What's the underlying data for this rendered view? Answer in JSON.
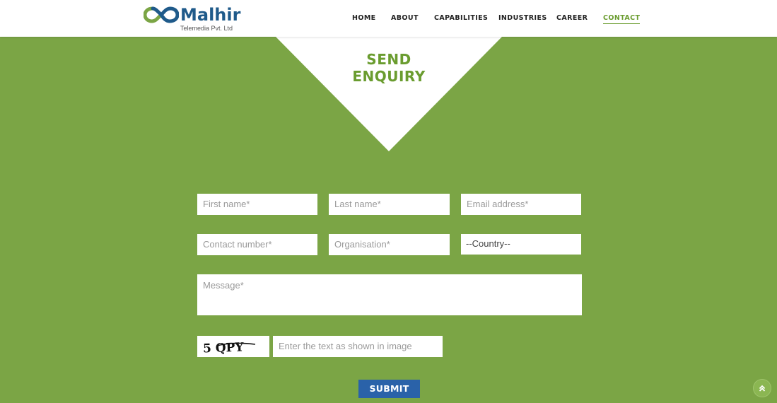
{
  "brand": {
    "name": "Malhir",
    "subtitle": "Telemedia Pvt. Ltd",
    "colors": {
      "primary_green": "#7ba545",
      "heading_green": "#6a9c2f",
      "logo_blue": "#1f5a8a",
      "submit_blue": "#2a62a9"
    }
  },
  "nav": {
    "items": [
      {
        "label": "HOME",
        "active": false
      },
      {
        "label": "ABOUT",
        "active": false
      },
      {
        "label": "CAPABILITIES",
        "active": false
      },
      {
        "label": "INDUSTRIES",
        "active": false
      },
      {
        "label": "CAREER",
        "active": false
      },
      {
        "label": "CONTACT",
        "active": true
      }
    ]
  },
  "enquiry": {
    "heading_line1": "SEND",
    "heading_line2": "ENQUIRY"
  },
  "form": {
    "first_name": {
      "placeholder": "First name*",
      "value": ""
    },
    "last_name": {
      "placeholder": "Last name*",
      "value": ""
    },
    "email": {
      "placeholder": "Email address*",
      "value": ""
    },
    "contact_number": {
      "placeholder": "Contact number*",
      "value": ""
    },
    "organisation": {
      "placeholder": "Organisation*",
      "value": ""
    },
    "country": {
      "selected": "--Country--"
    },
    "message": {
      "placeholder": "Message*",
      "value": ""
    },
    "captcha_text": "5 QPY",
    "captcha_input": {
      "placeholder": "Enter the text as shown in image",
      "value": ""
    },
    "submit_label": "SUBMIT"
  },
  "icons": {
    "logo": "infinity-logo-icon",
    "scroll_top": "double-chevron-up-icon"
  }
}
